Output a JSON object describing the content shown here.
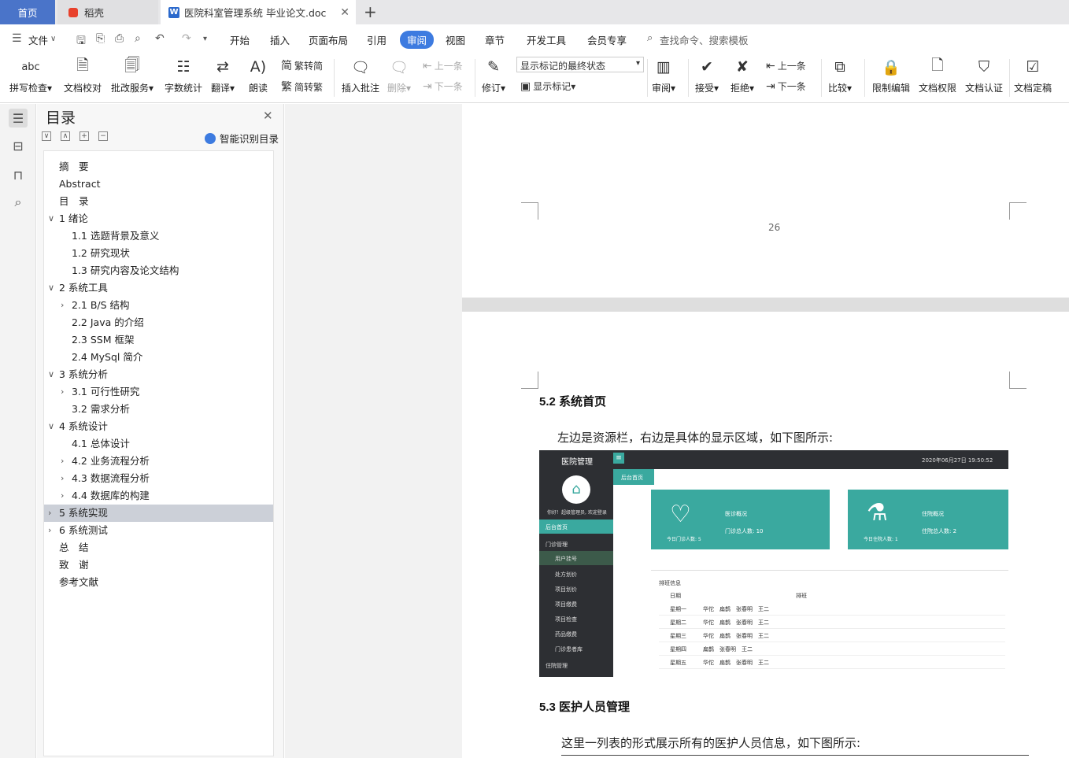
{
  "tabs": {
    "home": "首页",
    "daoke": "稻壳",
    "doc": "医院科室管理系统 毕业论文.doc",
    "doc_icon": "W"
  },
  "menu": {
    "file": "文件",
    "items": [
      "开始",
      "插入",
      "页面布局",
      "引用",
      "审阅",
      "视图",
      "章节",
      "开发工具",
      "会员专享"
    ],
    "search_placeholder": "查找命令、搜索模板"
  },
  "ribbon": {
    "spell": "拼写检查",
    "doc_check": "文档校对",
    "batch": "批改服务",
    "wordcount": "字数统计",
    "translate": "翻译",
    "read": "朗读",
    "trad_to_simp": "繁转简",
    "simp_to_trad": "简转繁",
    "insert_comment": "插入批注",
    "delete": "删除",
    "prev": "上一条",
    "next": "下一条",
    "track": "修订",
    "display_mode": "显示标记的最终状态",
    "show_markup": "显示标记",
    "review": "审阅",
    "accept": "接受",
    "reject": "拒绝",
    "prev2": "上一条",
    "next2": "下一条",
    "compare": "比较",
    "restrict": "限制编辑",
    "perm": "文档权限",
    "cert": "文档认证",
    "finalize": "文档定稿"
  },
  "toc": {
    "title": "目录",
    "smart": "智能识别目录",
    "items": [
      {
        "text": "摘　要",
        "level": 0,
        "arrow": ""
      },
      {
        "text": "Abstract",
        "level": 0,
        "arrow": ""
      },
      {
        "text": "目　录",
        "level": 0,
        "arrow": ""
      },
      {
        "text": "1 绪论",
        "level": 0,
        "arrow": "down"
      },
      {
        "text": "1.1 选题背景及意义",
        "level": 1,
        "arrow": ""
      },
      {
        "text": "1.2 研究现状",
        "level": 1,
        "arrow": ""
      },
      {
        "text": "1.3 研究内容及论文结构",
        "level": 1,
        "arrow": ""
      },
      {
        "text": "2 系统工具",
        "level": 0,
        "arrow": "down"
      },
      {
        "text": "2.1 B/S 结构",
        "level": 1,
        "arrow": "right"
      },
      {
        "text": "2.2 Java 的介绍",
        "level": 1,
        "arrow": ""
      },
      {
        "text": "2.3 SSM 框架",
        "level": 1,
        "arrow": ""
      },
      {
        "text": "2.4 MySql 简介",
        "level": 1,
        "arrow": ""
      },
      {
        "text": "3 系统分析",
        "level": 0,
        "arrow": "down"
      },
      {
        "text": "3.1 可行性研究",
        "level": 1,
        "arrow": "right"
      },
      {
        "text": "3.2  需求分析",
        "level": 1,
        "arrow": ""
      },
      {
        "text": "4 系统设计",
        "level": 0,
        "arrow": "down"
      },
      {
        "text": "4.1  总体设计",
        "level": 1,
        "arrow": ""
      },
      {
        "text": "4.2  业务流程分析",
        "level": 1,
        "arrow": "right"
      },
      {
        "text": "4.3 数据流程分析",
        "level": 1,
        "arrow": "right"
      },
      {
        "text": "4.4 数据库的构建",
        "level": 1,
        "arrow": "right"
      },
      {
        "text": "5 系统实现",
        "level": 0,
        "arrow": "right",
        "selected": true
      },
      {
        "text": "6 系统测试",
        "level": 0,
        "arrow": "right"
      },
      {
        "text": "总　结",
        "level": 0,
        "arrow": ""
      },
      {
        "text": "致　谢",
        "level": 0,
        "arrow": ""
      },
      {
        "text": "参考文献",
        "level": 0,
        "arrow": ""
      }
    ]
  },
  "document": {
    "page_number": "26",
    "h52": "5.2  系统首页",
    "p52": "左边是资源栏，右边是具体的显示区域，如下图所示:",
    "h53": "5.3  医护人员管理",
    "p53": "这里一列表的形式展示所有的医护人员信息，如下图所示:"
  },
  "screenshot": {
    "app_title": "医院管理",
    "datetime": "2020年06月27日 19:50:52",
    "breadcrumb": "后台首页",
    "welcome": "你好！超级管理员, 欢迎登录",
    "menu": [
      "后台首页",
      "门诊管理",
      "用户挂号",
      "处方划价",
      "项目划价",
      "项目缴费",
      "项目检查",
      "药品缴费",
      "门诊患者库",
      "住院管理"
    ],
    "card1_title": "医诊概况",
    "card1_stat": "门诊总人数: 10",
    "card1_today": "今日门诊人数: 5",
    "card2_title": "住院概况",
    "card2_stat": "住院总人数: 2",
    "card2_today": "今日住院人数: 1",
    "schedule_title": "排班信息",
    "col_date": "日期",
    "col_shift": "排班",
    "rows": [
      {
        "day": "星期一",
        "names": "华佗　扁鹊　张春明　王二"
      },
      {
        "day": "星期二",
        "names": "华佗　扁鹊　张春明　王二"
      },
      {
        "day": "星期三",
        "names": "华佗　扁鹊　张春明　王二"
      },
      {
        "day": "星期四",
        "names": "扁鹊　张春明　王二"
      },
      {
        "day": "星期五",
        "names": "华佗　扁鹊　张春明　王二"
      }
    ]
  }
}
